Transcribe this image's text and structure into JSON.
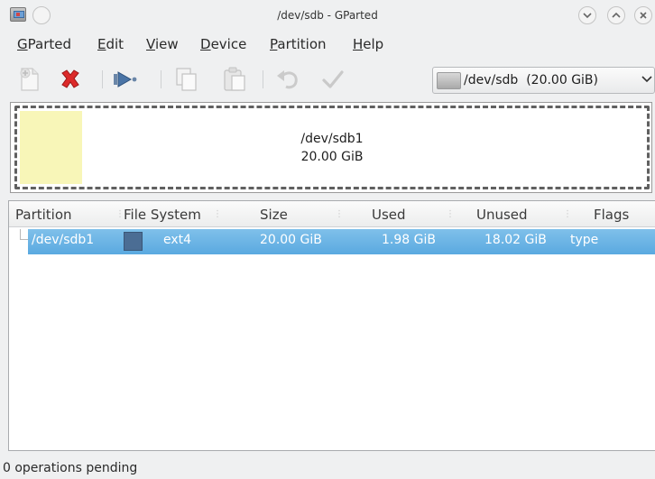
{
  "window": {
    "title": "/dev/sdb - GParted",
    "controls": [
      "minimize",
      "maximize",
      "close"
    ]
  },
  "menubar": {
    "items": [
      {
        "first": "G",
        "rest": "Parted"
      },
      {
        "first": "E",
        "rest": "dit"
      },
      {
        "first": "V",
        "rest": "iew"
      },
      {
        "first": "D",
        "rest": "evice"
      },
      {
        "first": "P",
        "rest": "artition"
      },
      {
        "first": "H",
        "rest": "elp"
      }
    ]
  },
  "toolbar": {
    "buttons": [
      "new-partition-icon",
      "delete-icon",
      "resize-move-icon",
      "copy-icon",
      "paste-icon",
      "undo-icon",
      "apply-icon"
    ],
    "device_selector": {
      "device": "/dev/sdb",
      "size": "(20.00 GiB)"
    }
  },
  "diskmap": {
    "partition": "/dev/sdb1",
    "size": "20.00 GiB",
    "used_fraction": 0.099
  },
  "table": {
    "columns": [
      "Partition",
      "File System",
      "Size",
      "Used",
      "Unused",
      "Flags"
    ],
    "rows": [
      {
        "partition": "/dev/sdb1",
        "filesystem": "ext4",
        "filesystem_color": "#4b6d94",
        "size": "20.00 GiB",
        "used": "1.98 GiB",
        "unused": "18.02 GiB",
        "flags": "type"
      }
    ]
  },
  "status": {
    "text": "0 operations pending"
  },
  "colors": {
    "selection": "#5aa9e0",
    "used_space": "#f8f6b8",
    "ext4": "#4b6d94"
  }
}
